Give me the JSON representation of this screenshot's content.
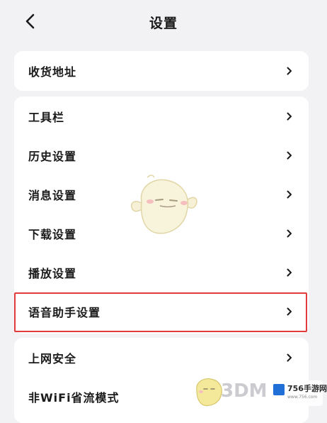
{
  "header": {
    "title": "设置"
  },
  "sections": [
    {
      "items": [
        {
          "label": "收货地址"
        }
      ]
    },
    {
      "items": [
        {
          "label": "工具栏"
        },
        {
          "label": "历史设置"
        },
        {
          "label": "消息设置"
        },
        {
          "label": "下载设置"
        },
        {
          "label": "播放设置"
        },
        {
          "label": "语音助手设置"
        }
      ]
    },
    {
      "items": [
        {
          "label": "上网安全"
        },
        {
          "label": "非WiFi省流模式"
        }
      ]
    }
  ],
  "highlighted_item": "语音助手设置",
  "colors": {
    "background": "#f2f2f4",
    "card": "#ffffff",
    "highlight_border": "#e23b3b"
  },
  "watermark": {
    "brand": "756手游网",
    "brand_sub": "www.756.com",
    "text_3dm": "3DM"
  }
}
